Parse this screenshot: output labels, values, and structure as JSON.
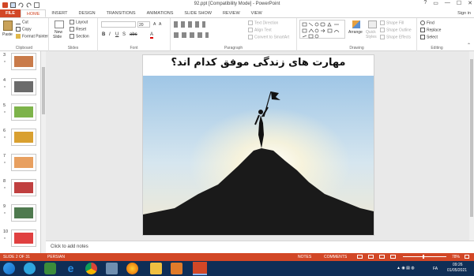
{
  "window": {
    "title": "92.ppt [Compatibility Mode] - PowerPoint",
    "controls": [
      "?",
      "▭",
      "—",
      "☐",
      "✕"
    ]
  },
  "tabs": [
    "FILE",
    "HOME",
    "INSERT",
    "DESIGN",
    "TRANSITIONS",
    "ANIMATIONS",
    "SLIDE SHOW",
    "REVIEW",
    "VIEW"
  ],
  "active_tab": "HOME",
  "sign_in": "Sign in",
  "ribbon": {
    "clipboard": {
      "label": "Clipboard",
      "paste": "Paste",
      "cut": "Cut",
      "copy": "Copy",
      "format_painter": "Format Painter"
    },
    "slides": {
      "label": "Slides",
      "new_slide": "New",
      "new_slide2": "Slide",
      "layout": "Layout",
      "reset": "Reset",
      "section": "Section"
    },
    "font": {
      "label": "Font",
      "size": "20"
    },
    "paragraph": {
      "label": "Paragraph",
      "text_direction": "Text Direction",
      "align_text": "Align Text",
      "convert_smartart": "Convert to SmartArt"
    },
    "drawing": {
      "label": "Drawing",
      "arrange": "Arrange",
      "quick_styles": "Quick",
      "quick_styles2": "Styles",
      "shape_fill": "Shape Fill",
      "shape_outline": "Shape Outline",
      "shape_effects": "Shape Effects"
    },
    "editing": {
      "label": "Editing",
      "find": "Find",
      "replace": "Replace",
      "select": "Select"
    }
  },
  "thumbnails": [
    {
      "num": "3",
      "star": "*",
      "color": "#c97b4a"
    },
    {
      "num": "4",
      "star": "*",
      "color": "#6b6b6b"
    },
    {
      "num": "5",
      "star": "*",
      "color": "#7db34a"
    },
    {
      "num": "6",
      "star": "*",
      "color": "#d9a030"
    },
    {
      "num": "7",
      "star": "*",
      "color": "#e8a060"
    },
    {
      "num": "8",
      "star": "*",
      "color": "#c04040"
    },
    {
      "num": "9",
      "star": "*",
      "color": "#4f7a4f"
    },
    {
      "num": "10",
      "star": "*",
      "color": "#e04040"
    }
  ],
  "slide": {
    "title": "مهارت های زندگی موفق کدام اند؟"
  },
  "notes_placeholder": "Click to add notes",
  "status": {
    "slide_counter": "SLIDE 2 OF 31",
    "language": "PERSIAN",
    "notes": "NOTES",
    "comments": "COMMENTS",
    "zoom": "78%"
  },
  "taskbar": {
    "lang": "FA",
    "time": "09:26",
    "date": "01/05/2021"
  },
  "colors": {
    "accent": "#d24726",
    "taskbar": "#0f2e56"
  }
}
